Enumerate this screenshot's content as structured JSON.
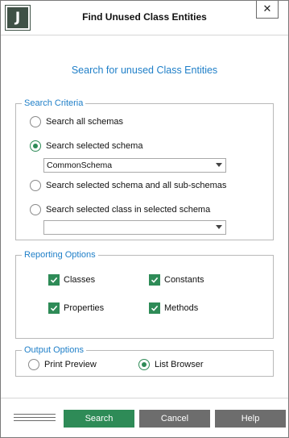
{
  "window": {
    "title": "Find Unused Class Entities",
    "app_icon_letter": "J",
    "close_glyph": "✕"
  },
  "heading": "Search for unused Class Entities",
  "search_criteria": {
    "legend": "Search Criteria",
    "options": [
      {
        "label": "Search all schemas",
        "checked": false
      },
      {
        "label": "Search selected schema",
        "checked": true
      },
      {
        "label": "Search selected schema and all sub-schemas",
        "checked": false
      },
      {
        "label": "Search selected class in selected schema",
        "checked": false
      }
    ],
    "schema_select_value": "CommonSchema",
    "class_select_value": ""
  },
  "reporting_options": {
    "legend": "Reporting Options",
    "items": [
      {
        "label": "Classes",
        "checked": true
      },
      {
        "label": "Constants",
        "checked": true
      },
      {
        "label": "Properties",
        "checked": true
      },
      {
        "label": "Methods",
        "checked": true
      }
    ]
  },
  "output_options": {
    "legend": "Output Options",
    "items": [
      {
        "label": "Print Preview",
        "checked": false
      },
      {
        "label": "List Browser",
        "checked": true
      }
    ]
  },
  "buttons": {
    "search": "Search",
    "cancel": "Cancel",
    "help": "Help"
  },
  "colors": {
    "accent_green": "#2e8b57",
    "link_blue": "#1f7fc8",
    "button_gray": "#6d6d6d",
    "icon_dark_green": "#3f5146"
  }
}
